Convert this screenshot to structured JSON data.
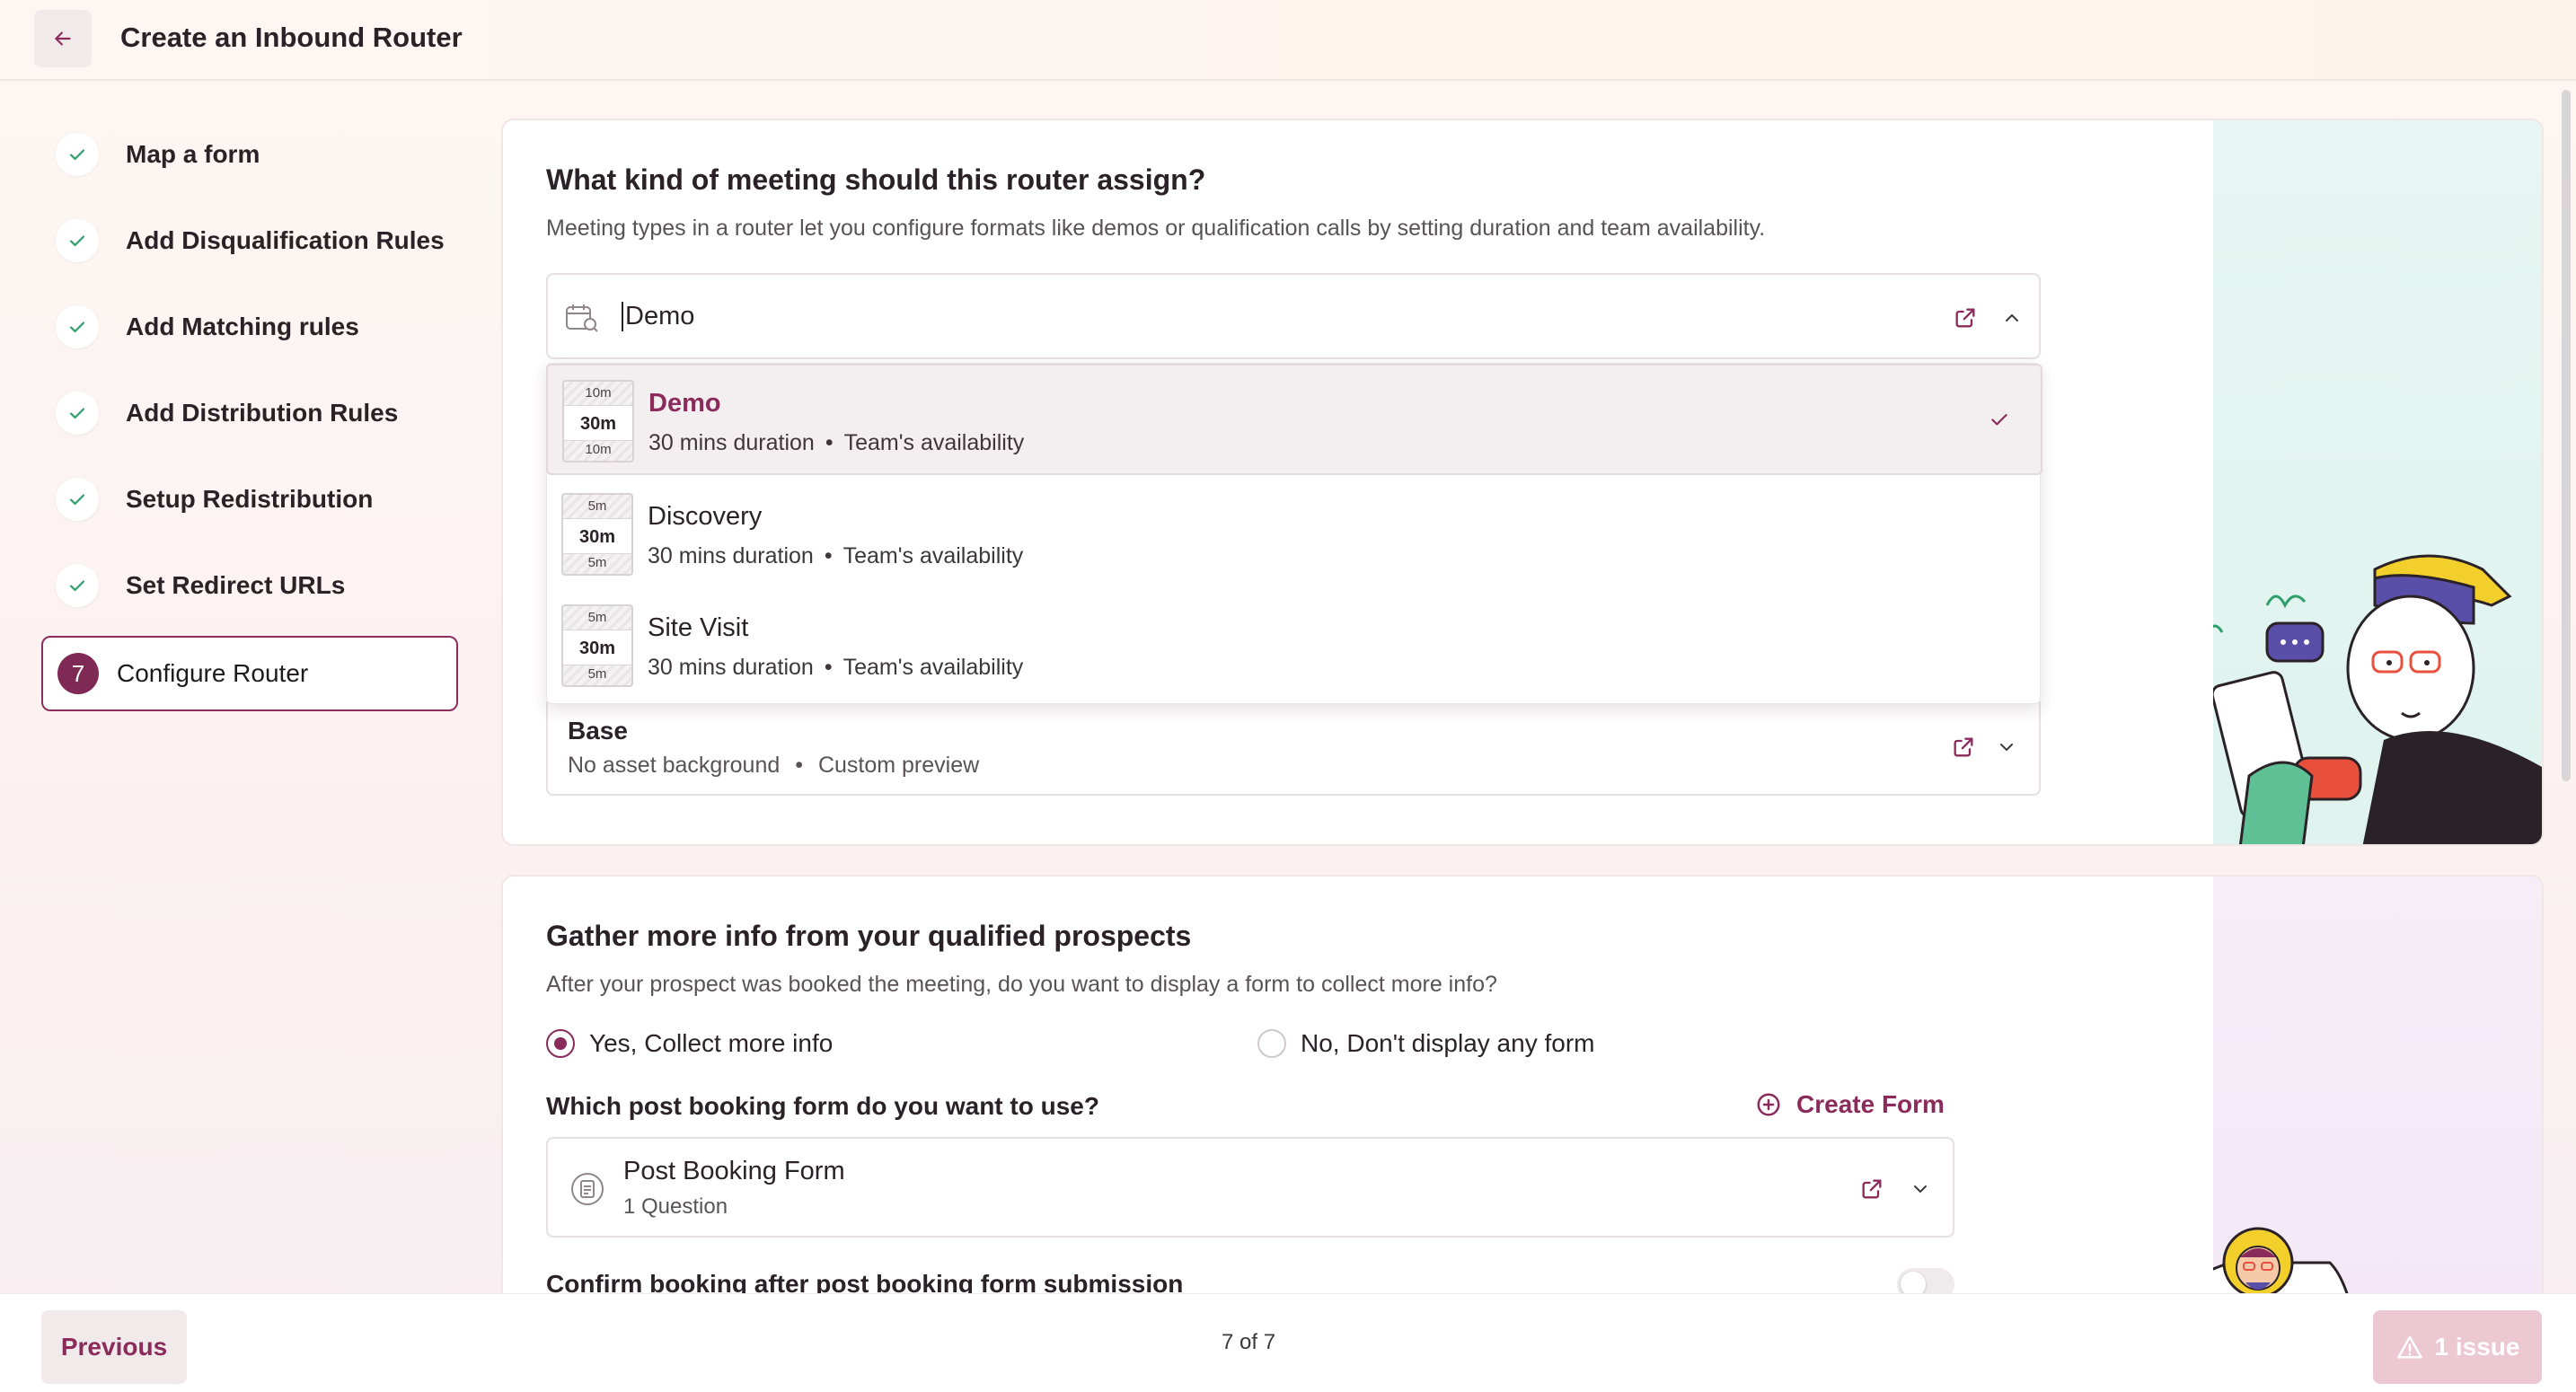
{
  "header": {
    "title": "Create an Inbound Router"
  },
  "sidebar": {
    "steps": [
      {
        "label": "Map a form"
      },
      {
        "label": "Add Disqualification Rules"
      },
      {
        "label": "Add Matching rules"
      },
      {
        "label": "Add Distribution Rules"
      },
      {
        "label": "Setup Redistribution"
      },
      {
        "label": "Set Redirect URLs"
      }
    ],
    "active": {
      "number": "7",
      "label": "Configure Router"
    }
  },
  "meeting": {
    "title": "What kind of meeting should this router assign?",
    "description": "Meeting types in a router let you configure formats like demos or qualification calls by setting duration and team availability.",
    "search_value": "Demo",
    "options": [
      {
        "name": "Demo",
        "duration": "30 mins duration",
        "availability": "Team's availability",
        "tile_top": "10m",
        "tile_mid": "30m",
        "tile_bot": "10m",
        "selected": true
      },
      {
        "name": "Discovery",
        "duration": "30 mins duration",
        "availability": "Team's availability",
        "tile_top": "5m",
        "tile_mid": "30m",
        "tile_bot": "5m",
        "selected": false
      },
      {
        "name": "Site Visit",
        "duration": "30 mins duration",
        "availability": "Team's availability",
        "tile_top": "5m",
        "tile_mid": "30m",
        "tile_bot": "5m",
        "selected": false
      }
    ],
    "base": {
      "title": "Base",
      "background": "No asset background",
      "preview": "Custom preview"
    }
  },
  "gather": {
    "title": "Gather more info from your qualified prospects",
    "description": "After your prospect was booked the meeting, do you want to display a form to collect more info?",
    "radio_yes": "Yes, Collect more info",
    "radio_no": "No, Don't display any form",
    "form_question": "Which post booking form do you want to use?",
    "create_form": "Create Form",
    "form_name": "Post Booking Form",
    "form_sub": "1 Question",
    "confirm_label": "Confirm booking after post booking form submission"
  },
  "footer": {
    "previous": "Previous",
    "pager": "7 of 7",
    "issue": "1 issue"
  },
  "colors": {
    "accent": "#8a2b5b",
    "check": "#2f9e6a"
  }
}
